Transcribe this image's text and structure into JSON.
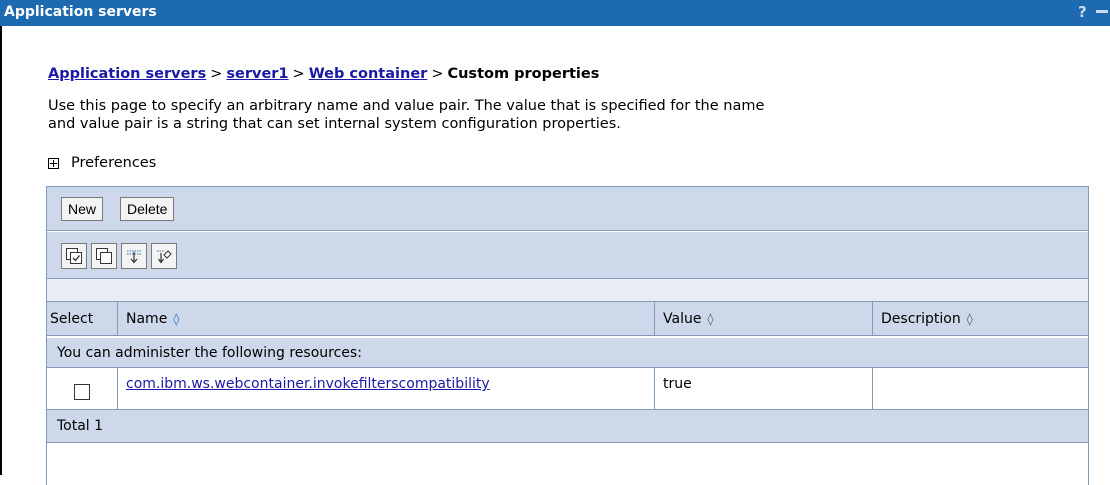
{
  "window": {
    "title": "Application servers",
    "help_label": "?"
  },
  "breadcrumb": {
    "items": [
      "Application servers",
      "server1",
      "Web container"
    ],
    "current": "Custom properties",
    "separator": ">"
  },
  "description": {
    "line1": "Use this page to specify an arbitrary name and value pair. The value that is specified for the name",
    "line2": "and value pair is a string that can set internal system configuration properties."
  },
  "preferences": {
    "label": "Preferences"
  },
  "toolbar": {
    "new_label": "New",
    "delete_label": "Delete"
  },
  "icon_toolbar": {
    "icons": [
      "select-all-icon",
      "deselect-all-icon",
      "show-filter-icon",
      "clear-filter-icon"
    ]
  },
  "table": {
    "headers": {
      "select": "Select",
      "name": "Name",
      "value": "Value",
      "description": "Description"
    },
    "sort_glyph": "◊",
    "info_text": "You can administer the following resources:",
    "rows": [
      {
        "name": "com.ibm.ws.webcontainer.invokefilterscompatibility",
        "value": "true",
        "description": "",
        "selected": false
      }
    ],
    "total_label": "Total 1"
  },
  "colors": {
    "title_bar": "#1d6ab0",
    "panel_bg": "#cdd8ea",
    "link": "#1a1aa6"
  }
}
